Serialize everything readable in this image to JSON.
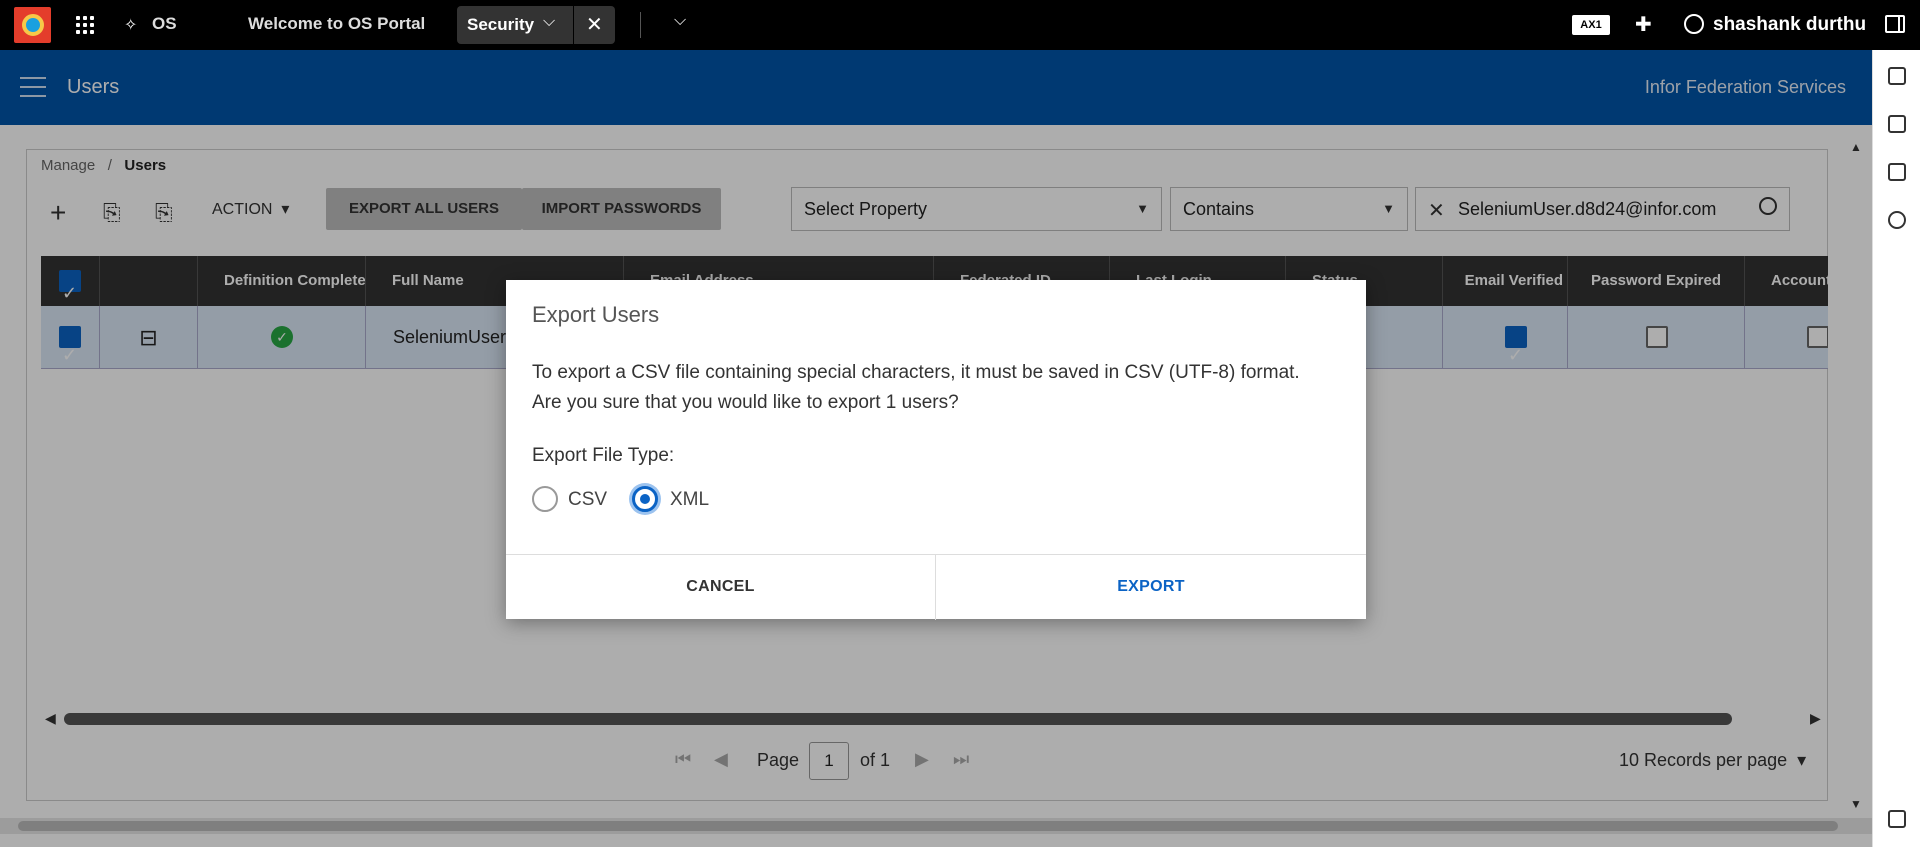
{
  "topbar": {
    "app_short": "OS",
    "portal_tab": "Welcome to OS Portal",
    "active_tab": "Security",
    "tenant_badge": "AX1",
    "user_name": "shashank durthu"
  },
  "header": {
    "title": "Users",
    "right_text": "Infor Federation Services"
  },
  "breadcrumb": {
    "parent": "Manage",
    "separator": "/",
    "current": "Users"
  },
  "toolbar": {
    "action_label": "ACTION",
    "export_all_label": "EXPORT ALL USERS",
    "import_passwords_label": "IMPORT PASSWORDS",
    "property_select": "Select Property",
    "operator_select": "Contains",
    "search_value": "SeleniumUser.d8d24@infor.com"
  },
  "table": {
    "columns": [
      "Definition Complete",
      "Full Name",
      "Email Address",
      "Federated ID",
      "Last Login",
      "Status",
      "Email Verified",
      "Password Expired",
      "Account"
    ],
    "rows": [
      {
        "full_name": "SeleniumUser"
      }
    ]
  },
  "pager": {
    "page_label": "Page",
    "page_value": "1",
    "of_label": "of 1",
    "records_per_page": "10 Records per page"
  },
  "dialog": {
    "title": "Export Users",
    "message_line1": "To export a CSV file containing special characters, it must be saved in CSV (UTF-8) format.",
    "message_line2": "Are you sure that you would like to export 1 users?",
    "file_type_label": "Export File Type:",
    "option_csv": "CSV",
    "option_xml": "XML",
    "selected": "XML",
    "cancel_label": "CANCEL",
    "export_label": "EXPORT"
  },
  "colors": {
    "accent_blue": "#0054a9",
    "link_blue": "#0b63c5",
    "table_header": "#333333"
  }
}
